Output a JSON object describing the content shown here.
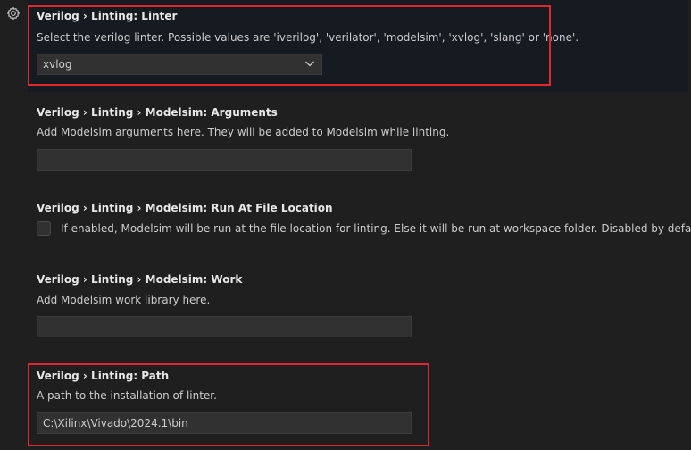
{
  "settings": [
    {
      "prefix": "Verilog",
      "sep": "›",
      "middle": "Linting",
      "suffix": "Linter",
      "description": "Select the verilog linter. Possible values are 'iverilog', 'verilator', 'modelsim', 'xvlog', 'slang' or 'none'.",
      "value": "xvlog",
      "control": "select"
    },
    {
      "prefix": "Verilog",
      "sep": "›",
      "middle": "Linting › Modelsim",
      "suffix": "Arguments",
      "description": "Add Modelsim arguments here. They will be added to Modelsim while linting.",
      "value": "",
      "control": "text"
    },
    {
      "prefix": "Verilog",
      "sep": "›",
      "middle": "Linting › Modelsim",
      "suffix": "Run At File Location",
      "description": "If enabled, Modelsim will be run at the file location for linting. Else it will be run at workspace folder. Disabled by default.",
      "checked": false,
      "control": "checkbox"
    },
    {
      "prefix": "Verilog",
      "sep": "›",
      "middle": "Linting › Modelsim",
      "suffix": "Work",
      "description": "Add Modelsim work library here.",
      "value": "",
      "control": "text"
    },
    {
      "prefix": "Verilog",
      "sep": "›",
      "middle": "Linting",
      "suffix": "Path",
      "description": "A path to the installation of linter.",
      "value": "C:\\Xilinx\\Vivado\\2024.1\\bin",
      "control": "text"
    }
  ],
  "titles": [
    "Verilog › Linting: Linter",
    "Verilog › Linting › Modelsim: Arguments",
    "Verilog › Linting › Modelsim: Run At File Location",
    "Verilog › Linting › Modelsim: Work",
    "Verilog › Linting: Path"
  ],
  "icons": {
    "gutter": "gear-icon",
    "dropdown": "chevron-down-icon"
  },
  "colors": {
    "highlight": "#e0262e",
    "background": "#1f1f1f",
    "focused_row": "#161b22"
  }
}
